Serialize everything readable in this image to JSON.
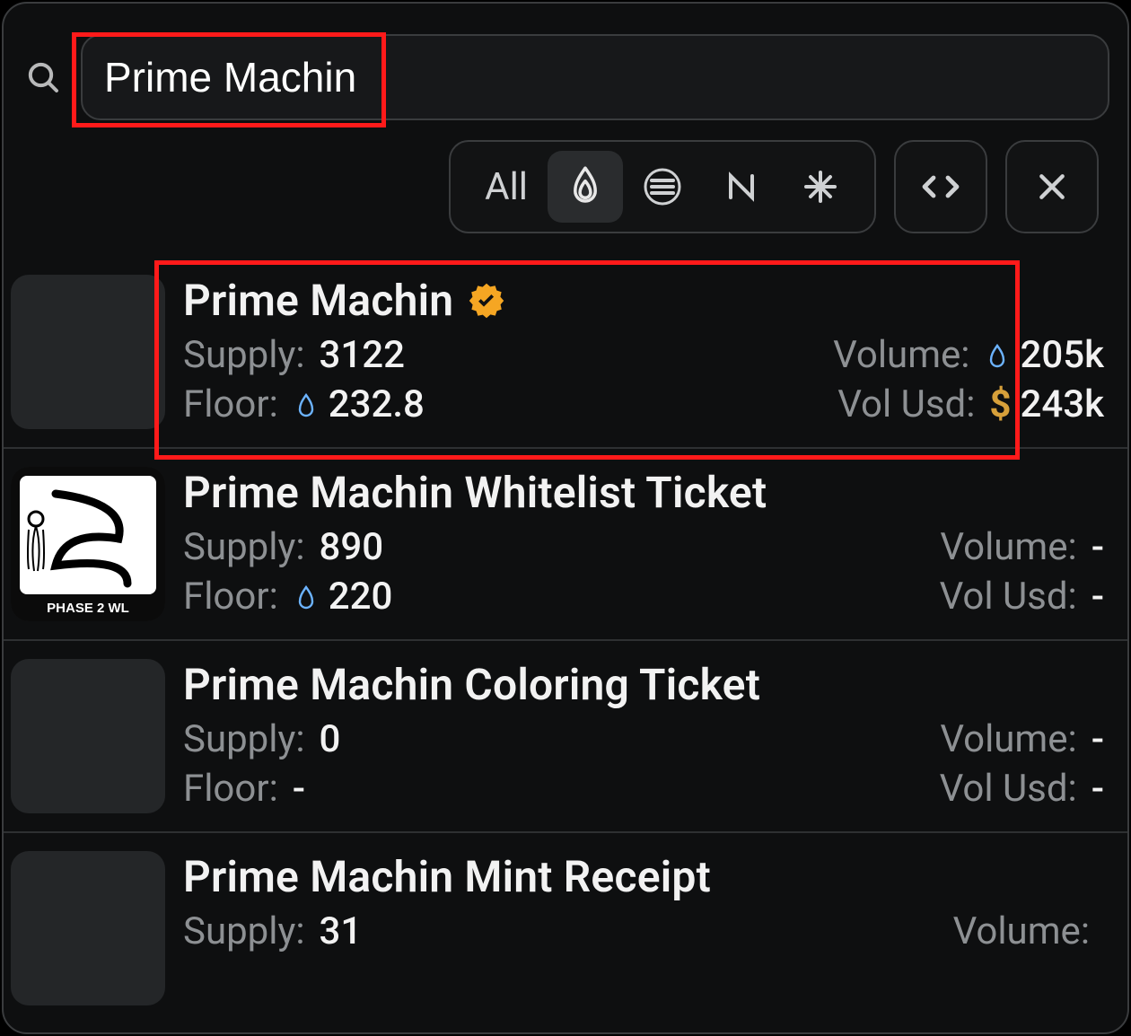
{
  "search": {
    "value": "Prime Machin"
  },
  "filters": {
    "all_label": "All",
    "active_index": 1
  },
  "labels": {
    "supply": "Supply:",
    "floor": "Floor:",
    "volume": "Volume:",
    "vol_usd": "Vol Usd:"
  },
  "results": [
    {
      "name": "Prime Machin",
      "verified": true,
      "thumb": "placeholder",
      "supply": "3122",
      "floor": "232.8",
      "floor_currency": "sui",
      "volume": "205k",
      "volume_currency": "sui",
      "vol_usd": "243k",
      "highlighted": true
    },
    {
      "name": "Prime Machin Whitelist Ticket",
      "verified": false,
      "thumb": "phase2wl",
      "supply": "890",
      "floor": "220",
      "floor_currency": "sui",
      "volume": "-",
      "volume_currency": null,
      "vol_usd": "-"
    },
    {
      "name": "Prime Machin Coloring Ticket",
      "verified": false,
      "thumb": "placeholder",
      "supply": "0",
      "floor": "-",
      "floor_currency": null,
      "volume": "-",
      "volume_currency": null,
      "vol_usd": "-"
    },
    {
      "name": "Prime Machin Mint Receipt",
      "verified": false,
      "thumb": "placeholder",
      "supply": "31",
      "floor": "",
      "floor_currency": null,
      "volume": "",
      "volume_currency": null,
      "vol_usd": "",
      "partial": true
    }
  ]
}
